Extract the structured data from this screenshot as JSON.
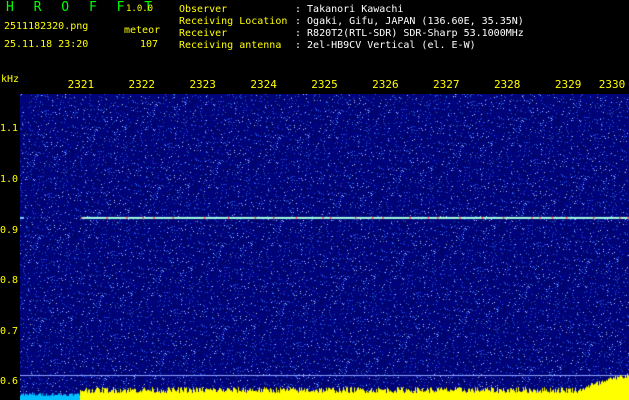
{
  "header": {
    "app_name": "H R O F F T",
    "version": "1.0.0",
    "filename": "2511182320.png",
    "datetime": "25.11.18 23:20",
    "type_label": "meteor",
    "count": "107",
    "info": [
      {
        "key": "Observer",
        "value": ": Takanori Kawachi"
      },
      {
        "key": "Receiving Location",
        "value": ": Ogaki, Gifu, JAPAN (136.60E, 35.35N)"
      },
      {
        "key": "Receiver",
        "value": ": R820T2(RTL-SDR) SDR-Sharp 53.1000MHz"
      },
      {
        "key": "Receiving antenna",
        "value": ": 2el-HB9CV Vertical (el. E-W)"
      }
    ]
  },
  "chart_data": {
    "type": "heatmap",
    "ylabel": "kHz",
    "x_ticks": [
      "2321",
      "2322",
      "2323",
      "2324",
      "2325",
      "2326",
      "2327",
      "2328",
      "2329",
      "2330"
    ],
    "x_range": [
      2320.0,
      2330.0
    ],
    "y_ticks": [
      "1.1",
      "1.0",
      "0.9",
      "0.8",
      "0.7",
      "0.6"
    ],
    "y_range": [
      0.565,
      1.17
    ],
    "signals": [
      {
        "freq_khz": 0.925,
        "x_start": 2321.0,
        "x_end": 2330.0
      }
    ]
  },
  "colors": {
    "green_text": "#00ff00",
    "yellow_text": "#ffff00",
    "white_text": "#ffffff",
    "background": "#000000",
    "noise_base": "#00066e",
    "signal": "#66ffcc",
    "level_bar": "#ffff00"
  }
}
